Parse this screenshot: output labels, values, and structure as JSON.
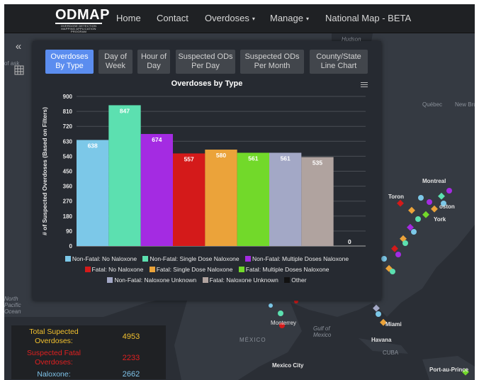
{
  "nav": {
    "logo_title": "ODMAP",
    "logo_subtitle": "OVERDOSE DETECTION MAPPING APPLICATION PROGRAM",
    "items": [
      {
        "label": "Home"
      },
      {
        "label": "Contact"
      },
      {
        "label": "Overdoses"
      },
      {
        "label": "Manage"
      },
      {
        "label": "National Map - BETA"
      }
    ]
  },
  "map_labels": {
    "hudson": "Hudson",
    "quebec": "Québec",
    "new_brunswick": "New Brunswick",
    "montreal": "Montreal",
    "toronto": "Toron",
    "boston": "oston",
    "new_york": "York",
    "north_pacific": "North Pacific Ocean",
    "gulf_of_mexico": "Gulf of Mexico",
    "monterrey": "Monterrey",
    "mexico": "MÉXICO",
    "miami": "Miami",
    "havana": "Havana",
    "cuba": "CUBA",
    "mexico_city": "Mexico City",
    "port_au_prince": "Port-au-Prince",
    "left_edge": "of ask"
  },
  "tabs": [
    {
      "label": "Overdoses By Type",
      "active": true
    },
    {
      "label": "Day of Week",
      "active": false
    },
    {
      "label": "Hour of Day",
      "active": false
    },
    {
      "label": "Suspected ODs Per Day",
      "active": false
    },
    {
      "label": "Suspected ODs Per Month",
      "active": false
    },
    {
      "label": "County/State Line Chart",
      "active": false
    }
  ],
  "chart_data": {
    "type": "bar",
    "title": "Overdoses by Type",
    "ylabel": "# of Suspected Overdoses (Based on Filters)",
    "xlabel": "",
    "ylim": [
      0,
      900
    ],
    "yticks": [
      0,
      90,
      180,
      270,
      360,
      450,
      540,
      630,
      720,
      810,
      900
    ],
    "grid": true,
    "legend_placement": "bottom",
    "series": [
      {
        "name": "Non-Fatal: No Naloxone",
        "value": 638,
        "color": "#7cc8e8"
      },
      {
        "name": "Non-Fatal: Single Dose Naloxone",
        "value": 847,
        "color": "#5ce0b0"
      },
      {
        "name": "Non-Fatal: Multiple Doses Naloxone",
        "value": 674,
        "color": "#a42be2"
      },
      {
        "name": "Fatal: No Naloxone",
        "value": 557,
        "color": "#d41a1a"
      },
      {
        "name": "Fatal: Single Dose Naloxone",
        "value": 580,
        "color": "#eba33a"
      },
      {
        "name": "Fatal: Multiple Doses Naloxone",
        "value": 561,
        "color": "#72d92a"
      },
      {
        "name": "Non-Fatal: Naloxone Unknown",
        "value": 561,
        "color": "#a3a8c6"
      },
      {
        "name": "Fatal: Naloxone Unknown",
        "value": 535,
        "color": "#b0a39f"
      },
      {
        "name": "Other",
        "value": 0,
        "color": "#111111"
      }
    ]
  },
  "stats": {
    "total_label": "Total Supected Overdoses:",
    "total_value": "4953",
    "total_color": "#f2c12e",
    "fatal_label": "Suspected Fatal Overdoses:",
    "fatal_value": "2233",
    "fatal_color": "#e02020",
    "naloxone_label": "Naloxone:",
    "naloxone_value": "2662",
    "naloxone_color": "#7fc4ea"
  },
  "icons": {
    "collapse": "double-chevron-left-icon",
    "layers": "layers-grid-icon",
    "chart_menu": "hamburger-menu-icon"
  }
}
